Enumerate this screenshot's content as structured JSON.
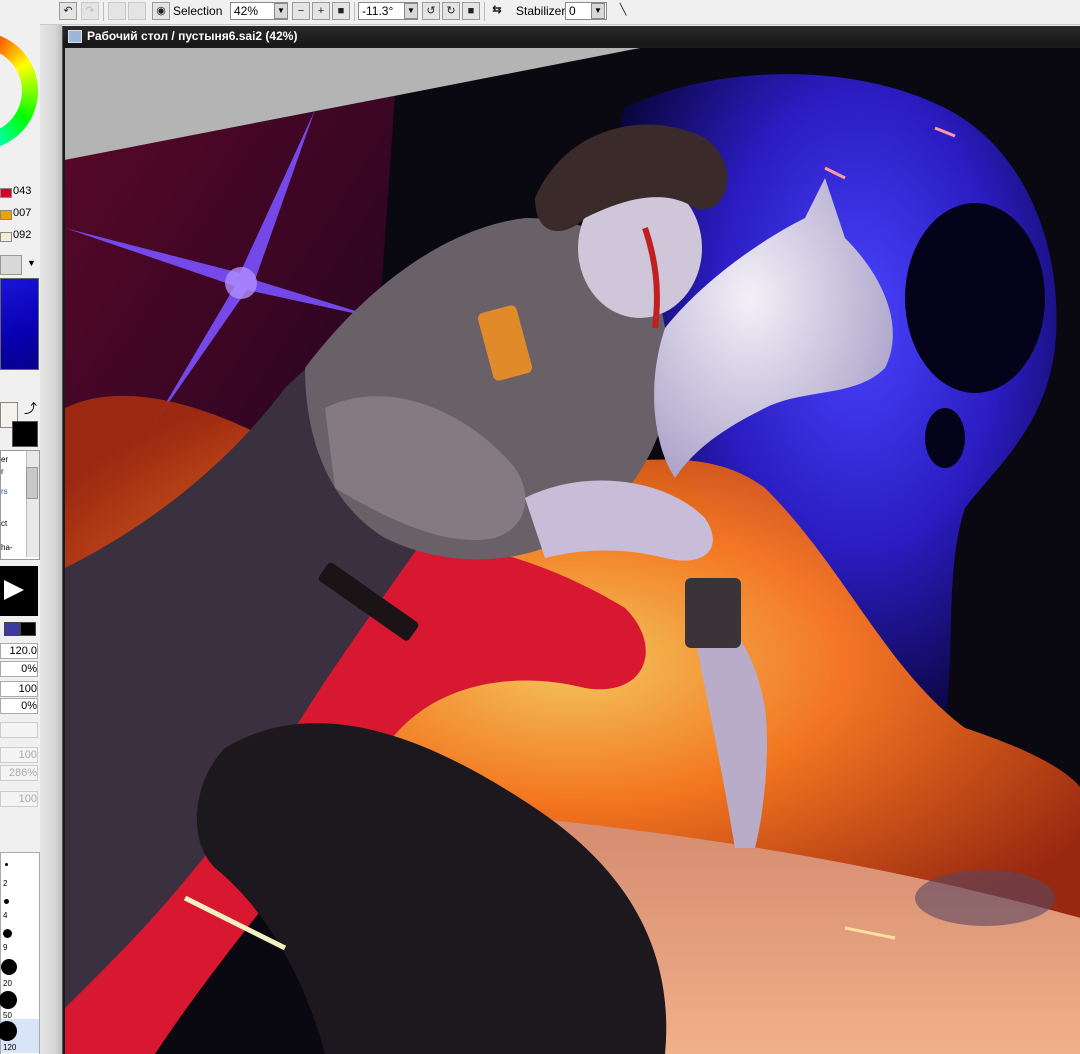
{
  "toolbar": {
    "zoom_label": "Selection",
    "zoom_value": "42%",
    "rotation_value": "-11.3°",
    "stabilizer_label": "Stabilizer",
    "stabilizer_value": "0"
  },
  "document": {
    "title": "Рабочий стол / пустыня6.sai2 (42%)"
  },
  "left_panel": {
    "slider_values": [
      "043",
      "007",
      "092"
    ],
    "tool_items": [
      "er",
      "r",
      "rs",
      "ct",
      "ha-"
    ],
    "brush_fields": [
      "120.0",
      "0%",
      "100",
      "0%"
    ],
    "dim_fields": [
      "100",
      "286%",
      "100"
    ],
    "brush_sizes": [
      "2",
      "4",
      "9",
      "20",
      "50",
      "120"
    ]
  },
  "colors": {
    "slider_red": "#d8002a",
    "slider_orange": "#f0a000",
    "slider_cream": "#f4ecd8",
    "primary_blue": "#0800b0",
    "secondary": "#f4f2ea",
    "foreground": "#000000"
  },
  "icons": {
    "undo": "undo-icon",
    "redo": "redo-icon",
    "eye": "eye-icon",
    "zoom_out": "minus-icon",
    "zoom_in": "plus-icon",
    "zoom_reset": "square-icon",
    "rotate_ccw": "rotate-ccw-icon",
    "rotate_cw": "rotate-cw-icon",
    "rotate_reset": "square-icon",
    "flip": "flip-arrows-icon",
    "stroke": "line-icon",
    "eraser": "eraser-icon",
    "swap": "swap-arrow-icon"
  }
}
